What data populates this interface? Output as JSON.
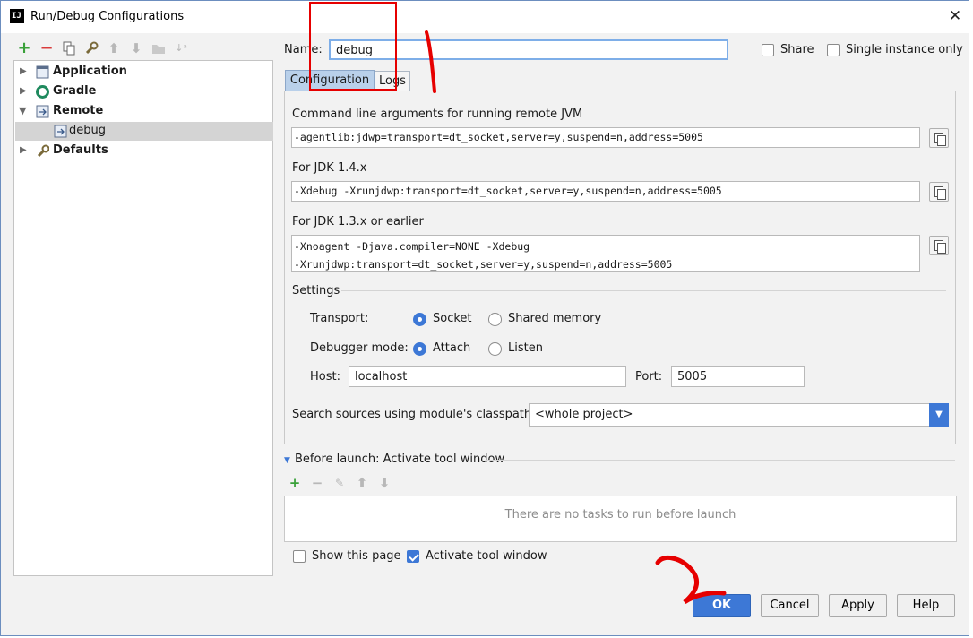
{
  "window": {
    "title": "Run/Debug Configurations",
    "close_glyph": "✕"
  },
  "toolbar": {
    "icons": [
      "add-icon",
      "remove-icon",
      "copy-icon",
      "wrench-icon",
      "move-up-icon",
      "move-down-icon",
      "folder-icon",
      "sort-icon"
    ]
  },
  "tree": {
    "items": [
      {
        "label": "Application",
        "bold": true,
        "icon": "application-icon"
      },
      {
        "label": "Gradle",
        "bold": true,
        "icon": "gradle-icon"
      },
      {
        "label": "Remote",
        "bold": true,
        "icon": "remote-icon",
        "expanded": true
      },
      {
        "label": "debug",
        "bold": false,
        "icon": "remote-config-icon",
        "selected": true
      },
      {
        "label": "Defaults",
        "bold": true,
        "icon": "wrench-icon"
      }
    ]
  },
  "form": {
    "name_label": "Name:",
    "name_value": "debug",
    "share_label": "Share",
    "single_instance_label": "Single instance only"
  },
  "tabs": [
    {
      "label": "Configuration",
      "active": true
    },
    {
      "label": "Logs",
      "active": false
    }
  ],
  "config": {
    "cmd_label": "Command line arguments for running remote JVM",
    "cmd_value": "-agentlib:jdwp=transport=dt_socket,server=y,suspend=n,address=5005",
    "jdk14_label": "For JDK 1.4.x",
    "jdk14_value": "-Xdebug -Xrunjdwp:transport=dt_socket,server=y,suspend=n,address=5005",
    "jdk13_label": "For JDK 1.3.x or earlier",
    "jdk13_line1": "-Xnoagent -Djava.compiler=NONE -Xdebug",
    "jdk13_line2": "-Xrunjdwp:transport=dt_socket,server=y,suspend=n,address=5005",
    "settings_label": "Settings",
    "transport_label": "Transport:",
    "transport_socket": "Socket",
    "transport_shared": "Shared memory",
    "debugger_mode_label": "Debugger mode:",
    "mode_attach": "Attach",
    "mode_listen": "Listen",
    "host_label": "Host:",
    "host_value": "localhost",
    "port_label": "Port:",
    "port_value": "5005",
    "search_label": "Search sources using module's classpath:",
    "search_value": "<whole project>"
  },
  "before_launch": {
    "header": "Before launch: Activate tool window",
    "empty_text": "There are no tasks to run before launch",
    "show_page_label": "Show this page",
    "activate_label": "Activate tool window"
  },
  "buttons": {
    "ok": "OK",
    "cancel": "Cancel",
    "apply": "Apply",
    "help": "Help"
  },
  "colors": {
    "accent": "#3d78d6",
    "annotation": "#e60000",
    "selection": "#d4d4d4",
    "tab_active": "#b9d0ea"
  }
}
